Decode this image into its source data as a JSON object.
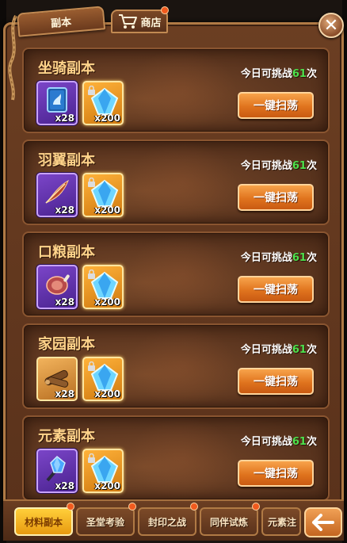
{
  "top_tabs": {
    "instance": "副本",
    "shop": "商店"
  },
  "close_label": "✕",
  "dungeons": [
    {
      "title": "坐骑副本",
      "attempts_prefix": "今日可挑战",
      "attempts_count": "61",
      "attempts_suffix": "次",
      "reward1_count": "x28",
      "reward2_count": "x200",
      "reward1_icon": "mount-book-icon",
      "reward2_icon": "blue-crystal-icon",
      "sweep_label": "一键扫荡"
    },
    {
      "title": "羽翼副本",
      "attempts_prefix": "今日可挑战",
      "attempts_count": "61",
      "attempts_suffix": "次",
      "reward1_count": "x28",
      "reward2_count": "x200",
      "reward1_icon": "feather-icon",
      "reward2_icon": "blue-crystal-icon",
      "sweep_label": "一键扫荡"
    },
    {
      "title": "口粮副本",
      "attempts_prefix": "今日可挑战",
      "attempts_count": "61",
      "attempts_suffix": "次",
      "reward1_count": "x28",
      "reward2_count": "x200",
      "reward1_icon": "meat-icon",
      "reward2_icon": "blue-crystal-icon",
      "sweep_label": "一键扫荡"
    },
    {
      "title": "家园副本",
      "attempts_prefix": "今日可挑战",
      "attempts_count": "61",
      "attempts_suffix": "次",
      "reward1_count": "x28",
      "reward2_count": "x200",
      "reward1_icon": "wood-log-icon",
      "reward2_icon": "blue-crystal-icon",
      "sweep_label": "一键扫荡"
    },
    {
      "title": "元素副本",
      "attempts_prefix": "今日可挑战",
      "attempts_count": "61",
      "attempts_suffix": "次",
      "reward1_count": "x28",
      "reward2_count": "x200",
      "reward1_icon": "element-crystal-icon",
      "reward2_icon": "blue-crystal-icon",
      "sweep_label": "一键扫荡"
    }
  ],
  "bottom_tabs": [
    {
      "label": "材料副本",
      "active": true
    },
    {
      "label": "圣堂考验",
      "active": false
    },
    {
      "label": "封印之战",
      "active": false
    },
    {
      "label": "同伴试炼",
      "active": false
    },
    {
      "label": "元素注",
      "active": false
    }
  ],
  "colors": {
    "attempts_count": "#4ce14c",
    "title": "#ffd38a",
    "sweep_button": "#e0741e",
    "active_tab": "#ffcf3a",
    "notification_dot": "#f05a1e"
  }
}
